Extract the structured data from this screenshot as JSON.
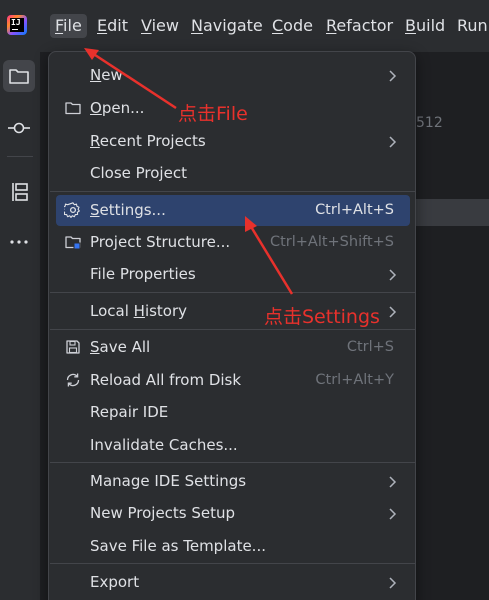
{
  "app": {
    "logo_letters": "IJ"
  },
  "menubar": {
    "items": [
      {
        "label": "File",
        "mnemonic": "F",
        "rest": "ile"
      },
      {
        "label": "Edit",
        "mnemonic": "E",
        "rest": "dit"
      },
      {
        "label": "View",
        "mnemonic": "V",
        "rest": "iew"
      },
      {
        "label": "Navigate",
        "mnemonic": "N",
        "rest": "avigate"
      },
      {
        "label": "Code",
        "mnemonic": "C",
        "rest": "ode"
      },
      {
        "label": "Refactor",
        "mnemonic": "R",
        "rest": "efactor"
      },
      {
        "label": "Build",
        "mnemonic": "B",
        "rest": "uild"
      },
      {
        "label": "Run",
        "mnemonic": "",
        "rest": "Run"
      }
    ]
  },
  "background": {
    "number_text": "512"
  },
  "file_menu": {
    "items": [
      {
        "label_u": "N",
        "label_rest": "ew",
        "shortcut": "",
        "submenu": true,
        "icon": ""
      },
      {
        "label_u": "O",
        "label_rest": "pen...",
        "shortcut": "",
        "submenu": false,
        "icon": "folder-icon"
      },
      {
        "label_u": "R",
        "label_rest": "ecent Projects",
        "shortcut": "",
        "submenu": true,
        "icon": ""
      },
      {
        "label_u": "",
        "label_rest": "Close Project",
        "shortcut": "",
        "submenu": false,
        "icon": ""
      },
      {
        "label_u": "",
        "label_rest": "Settings...",
        "label_full": "Settings...",
        "shortcut": "Ctrl+Alt+S",
        "submenu": false,
        "icon": "gear-icon",
        "highlighted": true
      },
      {
        "label_u": "",
        "label_rest": "Project Structure...",
        "shortcut": "Ctrl+Alt+Shift+S",
        "submenu": false,
        "icon": "project-structure-icon"
      },
      {
        "label_u": "",
        "label_rest": "File Properties",
        "shortcut": "",
        "submenu": true,
        "icon": ""
      },
      {
        "label_u": "",
        "label_rest": "Local History",
        "shortcut": "",
        "submenu": true,
        "icon": ""
      },
      {
        "label_u": "S",
        "label_rest": "ave All",
        "shortcut": "Ctrl+S",
        "submenu": false,
        "icon": "save-icon"
      },
      {
        "label_u": "",
        "label_rest": "Reload All from Disk",
        "shortcut": "Ctrl+Alt+Y",
        "submenu": false,
        "icon": "reload-icon"
      },
      {
        "label_u": "",
        "label_rest": "Repair IDE",
        "shortcut": "",
        "submenu": false,
        "icon": ""
      },
      {
        "label_u": "",
        "label_rest": "Invalidate Caches...",
        "shortcut": "",
        "submenu": false,
        "icon": ""
      },
      {
        "label_u": "",
        "label_rest": "Manage IDE Settings",
        "shortcut": "",
        "submenu": true,
        "icon": ""
      },
      {
        "label_u": "",
        "label_rest": "New Projects Setup",
        "shortcut": "",
        "submenu": true,
        "icon": ""
      },
      {
        "label_u": "",
        "label_rest": "Save File as Template...",
        "shortcut": "",
        "submenu": false,
        "icon": ""
      },
      {
        "label_u": "",
        "label_rest": "Export",
        "shortcut": "",
        "submenu": true,
        "icon": ""
      }
    ]
  },
  "annotations": {
    "click_file": "点击File",
    "click_settings": "点击Settings",
    "color": "#e8312c"
  },
  "colors": {
    "background": "#2b2d30",
    "editor": "#1e1f22",
    "highlight": "#2e436e",
    "text": "#dfe1e5",
    "shortcut": "#6f737a"
  }
}
